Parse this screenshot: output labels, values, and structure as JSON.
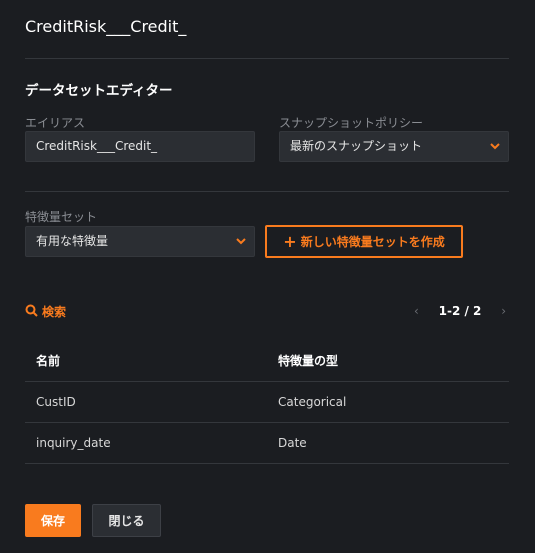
{
  "window": {
    "title": "CreditRisk___Credit_"
  },
  "editor": {
    "section_title": "データセットエディター",
    "alias": {
      "label": "エイリアス",
      "value": "CreditRisk___Credit_"
    },
    "snapshot_policy": {
      "label": "スナップショットポリシー",
      "selected": "最新のスナップショット"
    }
  },
  "feature_list": {
    "label": "特徴量セット",
    "selected": "有用な特徴量",
    "create_button_label": "新しい特徴量セットを作成"
  },
  "search": {
    "label": "検索",
    "icon": "search-icon"
  },
  "pagination": {
    "range": "1-2 / 2",
    "prev_icon": "chevron-left-icon",
    "next_icon": "chevron-right-icon"
  },
  "table": {
    "columns": [
      "名前",
      "特徴量の型"
    ],
    "rows": [
      [
        "CustID",
        "Categorical"
      ],
      [
        "inquiry_date",
        "Date"
      ]
    ]
  },
  "actions": {
    "save_label": "保存",
    "close_label": "閉じる"
  },
  "colors": {
    "accent": "#f97b1e",
    "background": "#1b1d21",
    "field": "#2b2e33"
  }
}
